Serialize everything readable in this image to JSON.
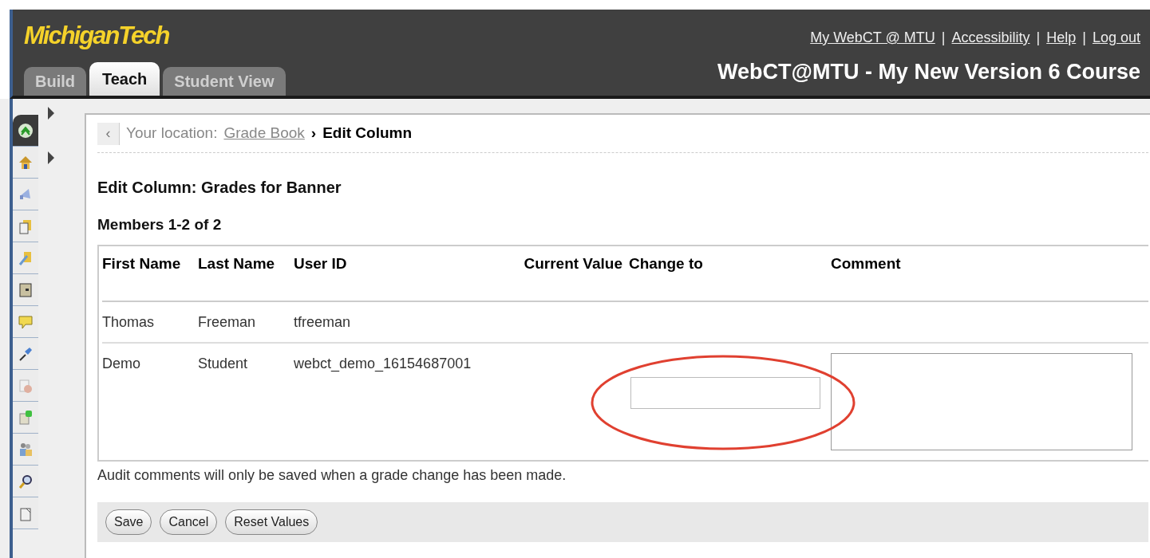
{
  "header": {
    "logo": "MichiganTech",
    "links": [
      "My WebCT @ MTU",
      "Accessibility",
      "Help",
      "Log out"
    ],
    "separator": "|",
    "course_title": "WebCT@MTU - My New Version 6 Course"
  },
  "tabs": [
    {
      "label": "Build",
      "selected": false
    },
    {
      "label": "Teach",
      "selected": true
    },
    {
      "label": "Student View",
      "selected": false
    }
  ],
  "breadcrumb": {
    "back": "‹",
    "prefix": "Your location:",
    "link": "Grade Book",
    "arrow": "›",
    "current": "Edit Column"
  },
  "title": "Edit Column: Grades for Banner",
  "members": "Members 1-2 of 2",
  "table": {
    "columns": [
      "First Name",
      "Last Name",
      "User ID",
      "Current Value",
      "Change to",
      "Comment"
    ],
    "rows": [
      {
        "cells": [
          "Thomas",
          "Freeman",
          "tfreeman"
        ],
        "editable": false
      },
      {
        "cells": [
          "Demo",
          "Student",
          "webct_demo_16154687001"
        ],
        "editable": true
      }
    ]
  },
  "note": "Audit comments will only be saved when a grade change has been made.",
  "buttons": [
    "Save",
    "Cancel",
    "Reset Values"
  ]
}
